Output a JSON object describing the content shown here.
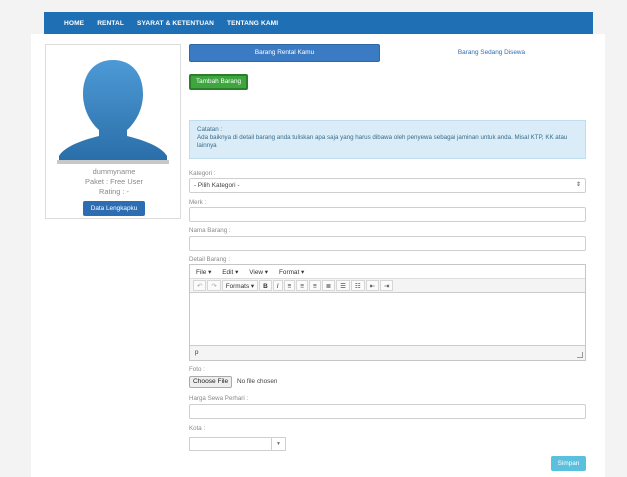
{
  "nav": {
    "items": [
      "HOME",
      "RENTAL",
      "SYARAT & KETENTUAN",
      "TENTANG KAMI"
    ]
  },
  "profile": {
    "username": "dummyname",
    "package": "Paket : Free User",
    "rating": "Rating : -",
    "details_button": "Data Lengkapku",
    "avatar_color": "#3d86c6"
  },
  "tabs": {
    "active": "Barang Rental Kamu",
    "inactive": "Barang Sedang Disewa"
  },
  "add_button": "Tambah Barang",
  "alert": {
    "title": "Catatan :",
    "body": "Ada baiknya di detail barang anda tuliskan apa saja yang harus dibawa oleh penyewa sebagai jaminan untuk anda. Misal KTP, KK atau lainnya"
  },
  "form": {
    "kategori_label": "Kategori :",
    "kategori_value": "- Pilih Kategori -",
    "merk_label": "Merk :",
    "nama_label": "Nama Barang :",
    "detail_label": "Detail Barang :",
    "foto_label": "Foto :",
    "foto_button": "Choose File",
    "foto_status": "No file chosen",
    "harga_label": "Harga Sewa Perhari :",
    "kota_label": "Kota :"
  },
  "editor": {
    "menu": [
      "File ▾",
      "Edit ▾",
      "View ▾",
      "Format ▾"
    ],
    "formats": "Formats ▾",
    "status_path": "p"
  },
  "save_button": "Simpan",
  "colors": {
    "nav": "#1f6fb5",
    "primary": "#3a7bc4",
    "success": "#3fa53f",
    "info": "#5bc0de"
  }
}
